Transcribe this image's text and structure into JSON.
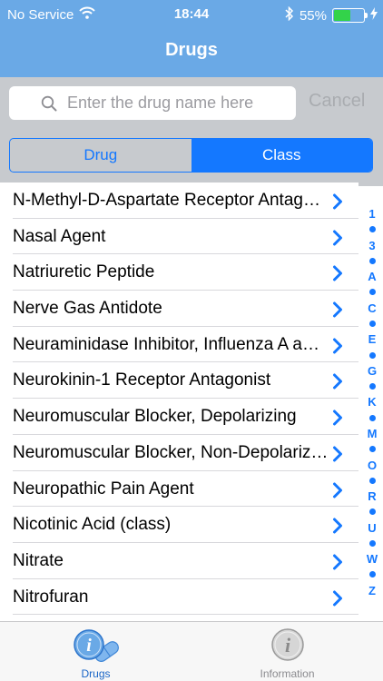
{
  "status_bar": {
    "carrier": "No Service",
    "time": "18:44",
    "battery": "55%",
    "battery_level": 0.55
  },
  "nav": {
    "title": "Drugs"
  },
  "search": {
    "placeholder": "Enter the drug name here",
    "value": "",
    "cancel_label": "Cancel"
  },
  "segment": {
    "items": [
      "Drug",
      "Class"
    ],
    "selected": "Class"
  },
  "list": {
    "items": [
      "N-Methyl-D-Aspartate Receptor Antagonist",
      "Nasal Agent",
      "Natriuretic Peptide",
      "Nerve Gas Antidote",
      "Neuraminidase Inhibitor, Influenza A and B",
      "Neurokinin-1 Receptor Antagonist",
      "Neuromuscular Blocker, Depolarizing",
      "Neuromuscular Blocker, Non-Depolarizing",
      "Neuropathic Pain Agent",
      "Nicotinic Acid (class)",
      "Nitrate",
      "Nitrofuran"
    ]
  },
  "index": [
    "1",
    "3",
    "A",
    "C",
    "E",
    "G",
    "K",
    "M",
    "O",
    "R",
    "U",
    "W",
    "Z"
  ],
  "tabbar": {
    "tabs": [
      {
        "label": "Drugs",
        "icon": "drugs-info-pill-icon",
        "active": true
      },
      {
        "label": "Information",
        "icon": "information-icon",
        "active": false
      }
    ]
  },
  "colors": {
    "header": "#6aa9e6",
    "accent": "#1478ff",
    "search_bg": "#c7cace",
    "battery_fill": "#33d34a"
  }
}
